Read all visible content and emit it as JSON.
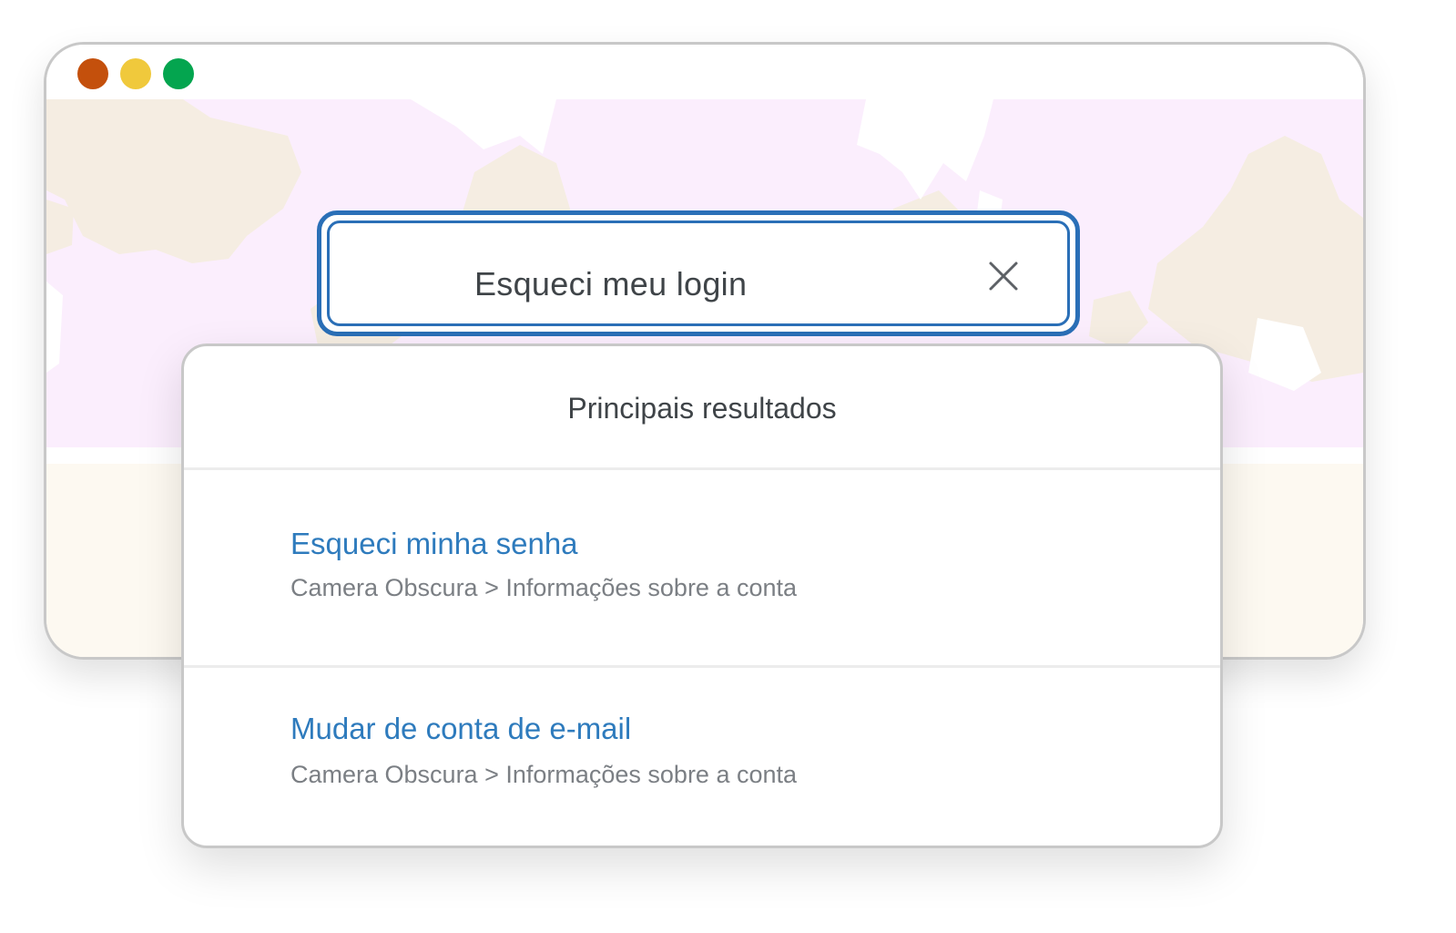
{
  "window": {
    "controls": {
      "close_color": "#c4500c",
      "minimize_color": "#f0c93c",
      "maximize_color": "#04a54f"
    },
    "hero_background": "#fbeefd",
    "lower_background": "#fdf9f1"
  },
  "search": {
    "value": "Esqueci meu login",
    "clear_icon": "close-icon",
    "accent_color": "#2a6fb7"
  },
  "results": {
    "heading": "Principais resultados",
    "items": [
      {
        "title": "Esqueci minha senha",
        "path": "Camera Obscura > Informações sobre a conta"
      },
      {
        "title": "Mudar de conta de e-mail",
        "path": "Camera Obscura > Informações sobre a conta"
      }
    ],
    "link_color": "#2e7bbd"
  }
}
